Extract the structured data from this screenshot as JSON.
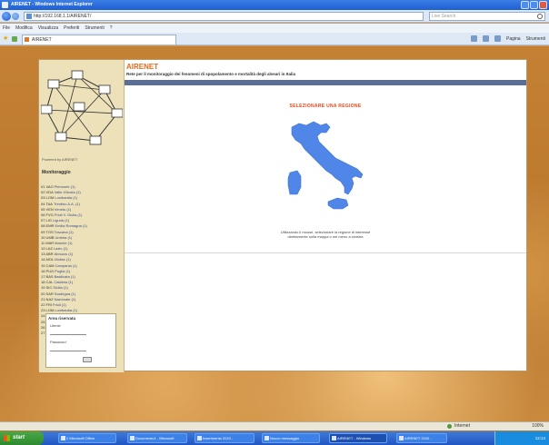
{
  "window": {
    "title": "AIRENET - Windows Internet Explorer"
  },
  "address": {
    "url": "http://192.168.1.1/AIRENET/",
    "search_placeholder": "Live Search"
  },
  "menu": [
    "File",
    "Modifica",
    "Visualizza",
    "Preferiti",
    "Strumenti",
    "?"
  ],
  "tab": {
    "title": "AIRENET"
  },
  "commands": {
    "page": "Pagina",
    "tools": "Strumenti"
  },
  "site": {
    "name": "AIRENET",
    "description": "Rete per il monitoraggio dei fenomeni di spopolamento e mortalità degli alveari in Italia",
    "copyright": "Powered by AIRENET",
    "menu_title": "Monitoraggio",
    "regions": [
      {
        "code": "01 VAO",
        "name": "Piemonte (1)"
      },
      {
        "code": "02 VDA",
        "name": "Valle d'Aosta (1)"
      },
      {
        "code": "03 LOM",
        "name": "Lombardia (1)"
      },
      {
        "code": "04 TAA",
        "name": "Trentino A.A. (1)"
      },
      {
        "code": "05 VEN",
        "name": "Veneto (1)"
      },
      {
        "code": "06 FVG",
        "name": "Friuli V. Giulia (1)"
      },
      {
        "code": "07 LIG",
        "name": "Liguria (1)"
      },
      {
        "code": "08 EMR",
        "name": "Emilia Romagna (1)"
      },
      {
        "code": "09 TOS",
        "name": "Toscana (1)"
      },
      {
        "code": "10 UMB",
        "name": "Umbria (1)"
      },
      {
        "code": "11 MAR",
        "name": "Marche (1)"
      },
      {
        "code": "12 LAZ",
        "name": "Lazio (1)"
      },
      {
        "code": "13 ABR",
        "name": "Abruzzo (1)"
      },
      {
        "code": "14 MOL",
        "name": "Molise (1)"
      },
      {
        "code": "15 CAM",
        "name": "Campania (1)"
      },
      {
        "code": "16 PUG",
        "name": "Puglia (1)"
      },
      {
        "code": "17 BAS",
        "name": "Basilicata (1)"
      },
      {
        "code": "18 CAL",
        "name": "Calabria (1)"
      },
      {
        "code": "19 SIC",
        "name": "Sicilia (1)"
      },
      {
        "code": "20 SAR",
        "name": "Sardegna (1)"
      },
      {
        "code": "21 NAZ",
        "name": "Nazionale (1)"
      },
      {
        "code": "22 FRI",
        "name": "Friuli (1)"
      },
      {
        "code": "23 LOM",
        "name": "Lombardia (1)"
      },
      {
        "code": "24 PAV",
        "name": "Pavia (1)"
      },
      {
        "code": "25 PIE",
        "name": "Piemonte (1)"
      },
      {
        "code": "26 TOS",
        "name": "Toscana (1)"
      },
      {
        "code": "27 VEN",
        "name": "Veneto (1)"
      }
    ],
    "login": {
      "title": "Area riservata",
      "user_label": "Utente",
      "password_label": "Password"
    }
  },
  "main": {
    "select_title": "SELEZIONARE UNA REGIONE",
    "instructions_line1": "Utilizzando il mouse, selezionare la regione di interesse",
    "instructions_line2": "direttamente sulla mappa o nel menu a sinistra"
  },
  "status": {
    "zone": "Internet",
    "zoom": "100%"
  },
  "taskbar": {
    "start": "start",
    "tasks": [
      "2 Microsoft Office",
      "Documento1 - Microsoft",
      "Inserimento 2010 -",
      "Nuovo messaggio",
      "AIRENET - Windows",
      "AIRENET 2010 -"
    ],
    "clock": "12:14"
  }
}
